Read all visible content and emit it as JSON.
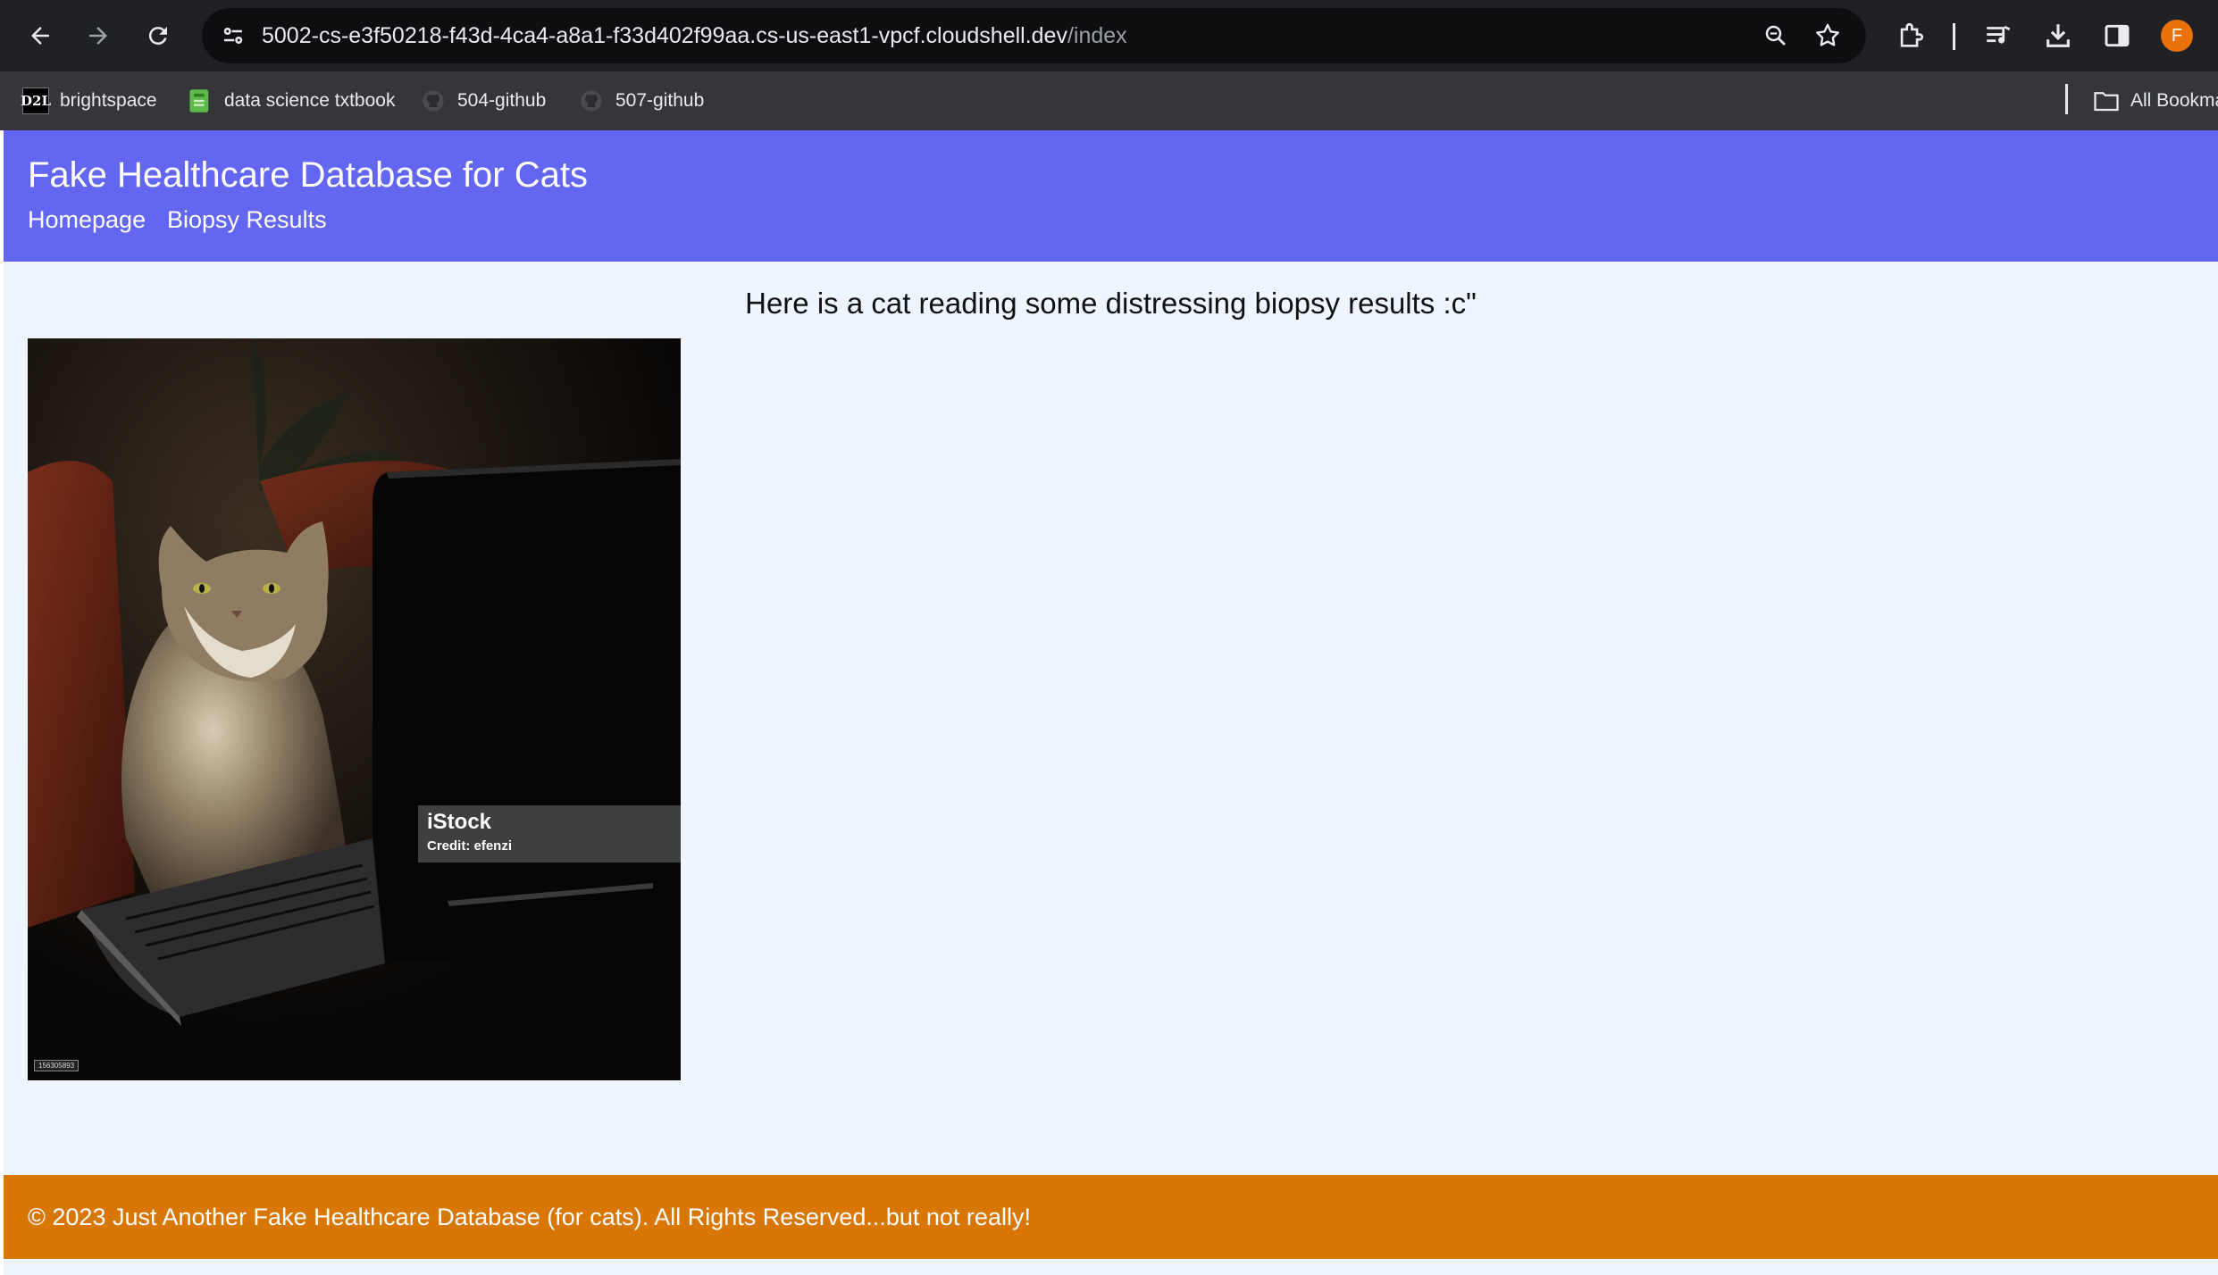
{
  "browser": {
    "url_host": "5002-cs-e3f50218-f43d-4ca4-a8a1-f33d402f99aa.cs-us-east1-vpcf.cloudshell.dev",
    "url_path": "/index",
    "profile_initial": "F",
    "bookmarks": [
      {
        "label": "brightspace",
        "icon": "d2l-icon",
        "icon_text": "D2L"
      },
      {
        "label": "data science txtbook",
        "icon": "book-icon"
      },
      {
        "label": "504-github",
        "icon": "github-icon"
      },
      {
        "label": "507-github",
        "icon": "github-icon"
      }
    ],
    "all_bookmarks_label": "All Bookmarks"
  },
  "site": {
    "title": "Fake Healthcare Database for Cats",
    "nav": [
      {
        "label": "Homepage"
      },
      {
        "label": "Biopsy Results"
      }
    ]
  },
  "main": {
    "caption": "Here is a cat reading some distressing biopsy results :c\"",
    "image": {
      "watermark_brand": "iStock",
      "watermark_credit": "Credit: efenzi",
      "stock_id": "156305893"
    }
  },
  "footer": {
    "text": "© 2023 Just Another Fake Healthcare Database (for cats). All Rights Reserved...but not really!"
  },
  "colors": {
    "header": "#6366f1",
    "page_bg": "#eef5ff",
    "footer": "#d97706",
    "browser_toolbar": "#202124",
    "bookmarks_bar": "#35363a"
  }
}
